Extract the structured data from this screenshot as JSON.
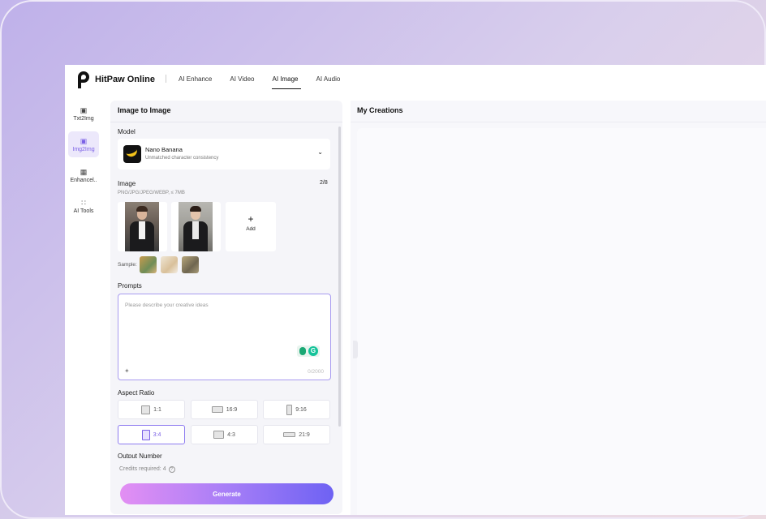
{
  "header": {
    "brand": "HitPaw Online",
    "nav": [
      "AI Enhance",
      "AI Video",
      "AI Image",
      "AI Audio"
    ],
    "active_nav": "AI Image"
  },
  "rail": [
    {
      "label": "Txt2Img",
      "icon": "text-to-image-icon"
    },
    {
      "label": "Img2Img",
      "icon": "image-to-image-icon",
      "active": true
    },
    {
      "label": "Enhancel..",
      "icon": "enhance-icon"
    },
    {
      "label": "AI Tools",
      "icon": "tools-icon"
    }
  ],
  "panel": {
    "title": "Image to Image",
    "model_label": "Model",
    "model_name": "Nano Banana",
    "model_desc": "Unmatched character consistency",
    "image_label": "Image",
    "image_count": "2/8",
    "image_formats": "PNG/JPG/JPEG/WEBP, ≤ 7MB",
    "add_label": "Add",
    "samples_label": "Sample:",
    "prompts_label": "Prompts",
    "prompt_placeholder": "Please describe your creative ideas",
    "prompt_counter": "0/2000",
    "aspect_label": "Aspect Ratio",
    "ratios": [
      "1:1",
      "16:9",
      "9:16",
      "3:4",
      "4:3",
      "21:9"
    ],
    "active_ratio": "3:4",
    "output_label": "Output Number",
    "credits": "Credits required: 4",
    "generate": "Generate"
  },
  "right": {
    "title": "My Creations"
  },
  "colors": {
    "accent": "#7b61e6",
    "generate_start": "#e38ff3",
    "generate_end": "#6e62f3"
  }
}
